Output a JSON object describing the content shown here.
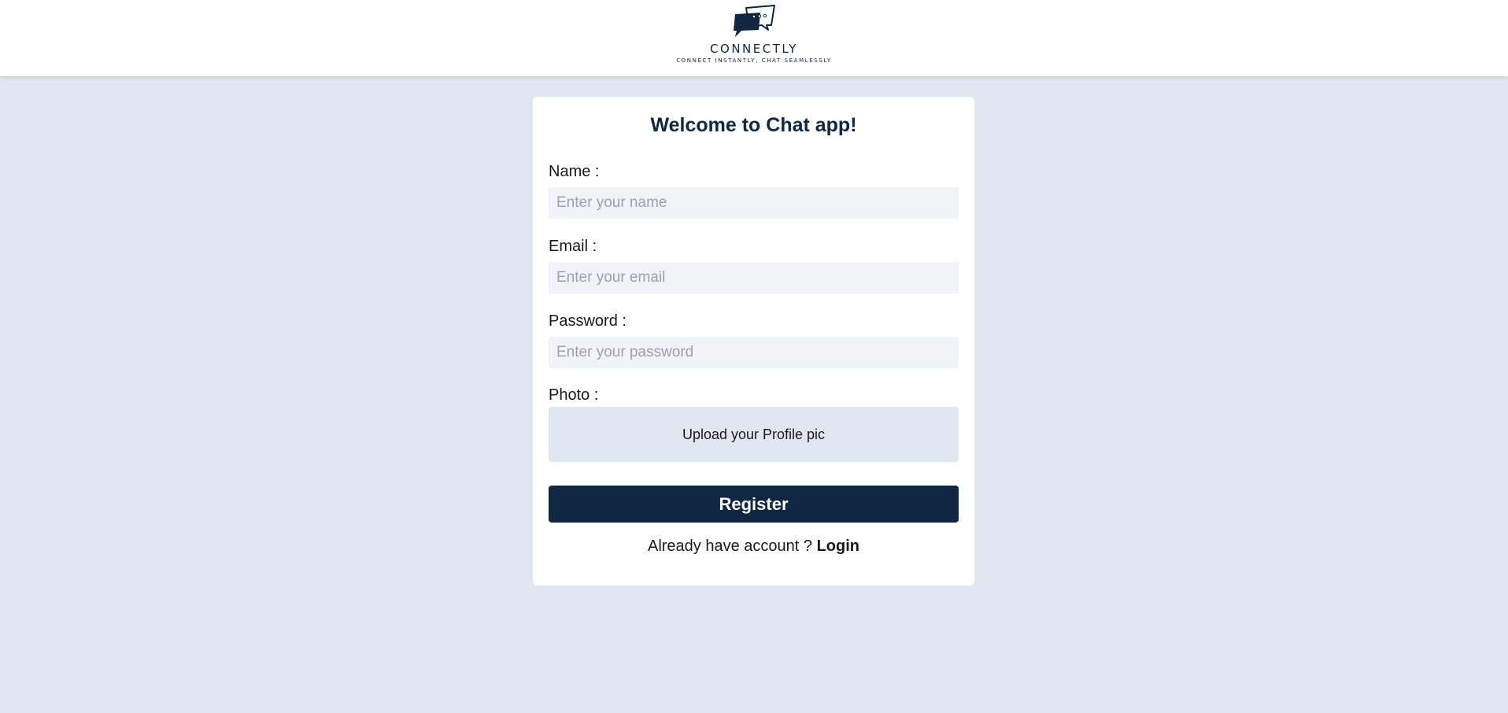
{
  "header": {
    "brand_name": "CONNECTLY",
    "tagline": "CONNECT INSTANTLY, CHAT SEAMLESSLY",
    "logo_icon": "chat-bubbles-icon",
    "brand_color": "#0f2740"
  },
  "form": {
    "title": "Welcome to Chat app!",
    "name_label": "Name :",
    "name_placeholder": "Enter your name",
    "name_value": "",
    "email_label": "Email :",
    "email_placeholder": "Enter your email",
    "email_value": "",
    "password_label": "Password :",
    "password_placeholder": "Enter your password",
    "password_value": "",
    "photo_label": "Photo :",
    "upload_text": "Upload your Profile pic",
    "register_label": "Register",
    "login_prompt": "Already have account ?",
    "login_link": "Login"
  },
  "colors": {
    "page_background": "#e0e7f0",
    "card_background": "#ffffff",
    "input_background": "#f0f3f7",
    "button_background": "#0f2740",
    "button_text": "#ffffff"
  }
}
